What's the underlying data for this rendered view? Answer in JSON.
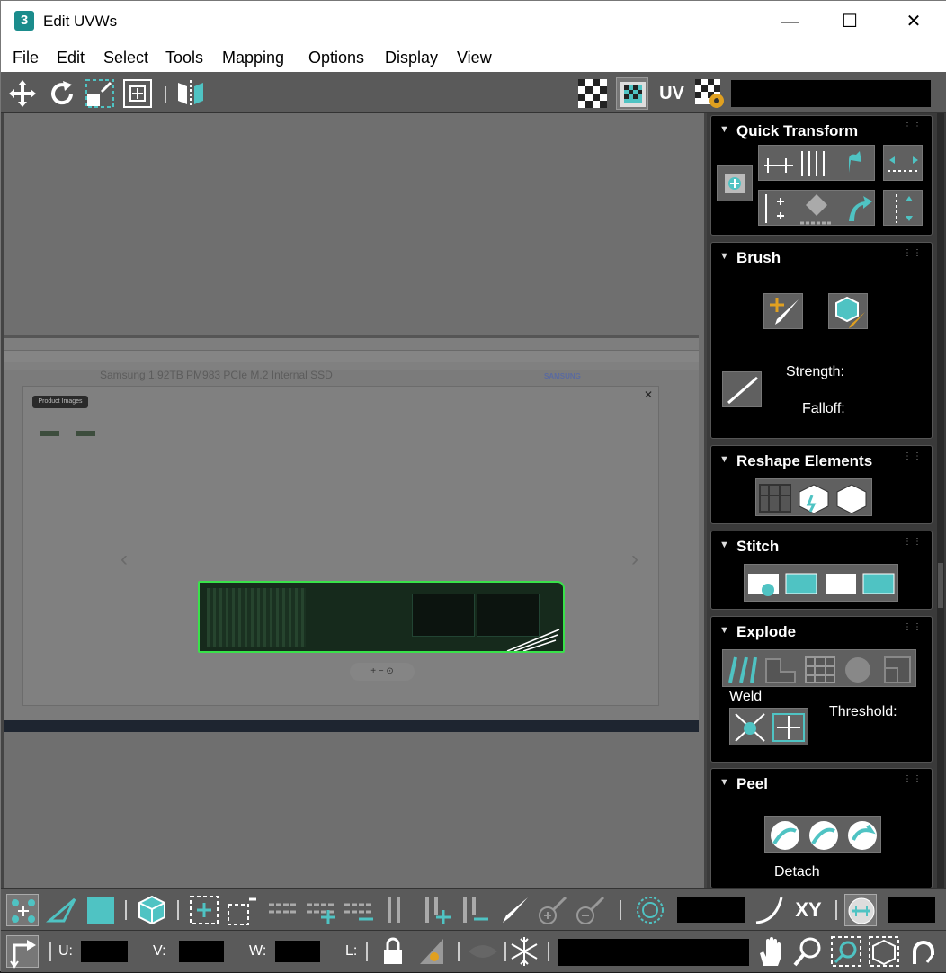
{
  "window": {
    "title": "Edit UVWs",
    "icon_glyph": "3",
    "minimize_glyph": "—",
    "maximize_glyph": "☐",
    "close_glyph": "✕"
  },
  "menubar": {
    "items": [
      "File",
      "Edit",
      "Select",
      "Tools",
      "Mapping",
      "Options",
      "Display",
      "View"
    ]
  },
  "toolbar": {
    "uv_label": "UV"
  },
  "viewport": {
    "zoom_controls": "+  −  ⊙",
    "modal_close": "✕",
    "chev_left": "‹",
    "chev_right": "›",
    "background_heading": "Samsung 1.92TB PM983 PCIe M.2 Internal SSD",
    "background_brand": "SAMSUNG",
    "background_button": "Product Images",
    "ssd_outline_color": "#39e24a"
  },
  "panel": {
    "quick_transform": {
      "title": "Quick Transform"
    },
    "brush": {
      "title": "Brush",
      "strength_label": "Strength:",
      "falloff_label": "Falloff:"
    },
    "reshape": {
      "title": "Reshape Elements"
    },
    "stitch": {
      "title": "Stitch"
    },
    "explode": {
      "title": "Explode",
      "weld_label": "Weld",
      "threshold_label": "Threshold:"
    },
    "peel": {
      "title": "Peel",
      "detach_label": "Detach"
    },
    "accent_color": "#4fc3c3"
  },
  "bottom": {
    "xy_label": "XY",
    "u_label": "U:",
    "v_label": "V:",
    "w_label": "W:",
    "l_label": "L:"
  }
}
